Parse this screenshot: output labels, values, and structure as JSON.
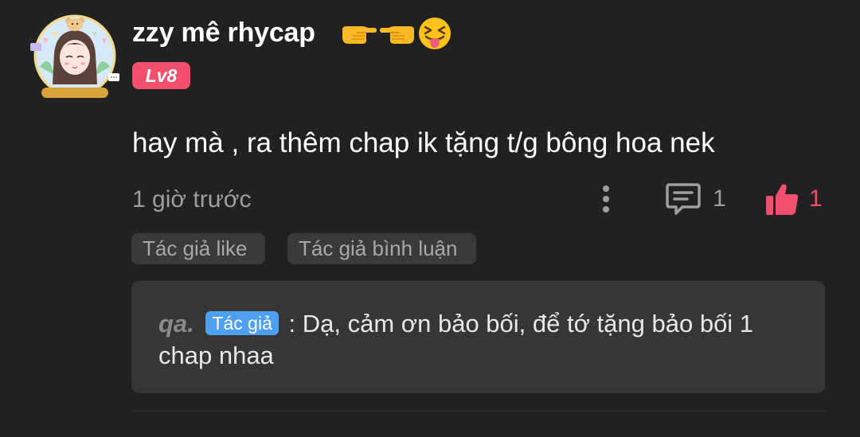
{
  "comment": {
    "username": "zzy mê rhycap",
    "emojis": [
      "pointing-right-emoji",
      "pointing-left-emoji",
      "squinting-tongue-emoji"
    ],
    "level": "Lv8",
    "avatar_caption": "Giải thiệu Truyện chat",
    "text": "hay mà , ra thêm chap ik tặng t/g bông hoa nek",
    "timestamp": "1 giờ trước",
    "reply_count": "1",
    "like_count": "1",
    "tags": [
      "Tác giả like",
      "Tác giả bình luận"
    ]
  },
  "reply": {
    "author": "qa",
    "separator": ".",
    "badge": "Tác giả",
    "colon": ":",
    "text": "Dạ, cảm ơn bảo bối, để tớ tặng bảo bối 1 chap nhaa"
  },
  "colors": {
    "background": "#212121",
    "accent_pink": "#f0506e",
    "author_badge_blue": "#4f9ff2",
    "muted_text": "#9e9e9e",
    "reply_box": "#363636"
  }
}
